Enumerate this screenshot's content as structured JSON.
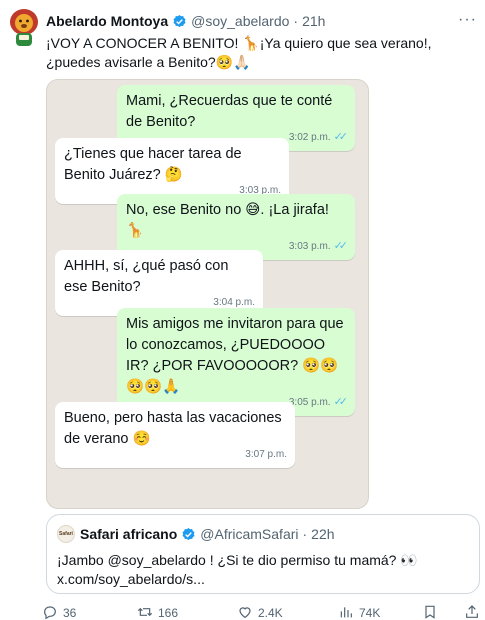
{
  "tweet": {
    "author_name": "Abelardo Montoya",
    "handle": "@soy_abelardo",
    "separator": "·",
    "time": "21h",
    "more": "···",
    "text": "¡VOY A CONOCER A BENITO! 🦒¡Ya quiero que sea verano!, ¿puedes avisarle a Benito?🥺🙏🏻"
  },
  "chat": {
    "messages": [
      {
        "side": "out",
        "text": "Mami, ¿Recuerdas que te conté de Benito?",
        "time": "3:02 p.m.",
        "ticks": "✓✓"
      },
      {
        "side": "in",
        "text": "¿Tienes que hacer tarea de Benito Juárez? 🤔",
        "time": "3:03 p.m."
      },
      {
        "side": "out",
        "text": "No, ese Benito no 😅. ¡La jirafa! 🦒",
        "time": "3:03 p.m.",
        "ticks": "✓✓"
      },
      {
        "side": "in",
        "text": "AHHH, sí, ¿qué pasó con ese Benito?",
        "time": "3:04 p.m."
      },
      {
        "side": "out",
        "text": "Mis amigos me invitaron para que lo conozcamos, ¿PUEDOOOO IR? ¿POR FAVOOOOOR? 🥺🥺🥺🥺🙏",
        "time": "3:05 p.m.",
        "ticks": "✓✓"
      },
      {
        "side": "in",
        "text": "Bueno, pero hasta las vacaciones de verano ☺️",
        "time": "3:07 p.m."
      }
    ]
  },
  "quote": {
    "avatar_text": "Safari",
    "author_name": "Safari africano",
    "handle": "@AfricamSafari",
    "separator": "·",
    "time": "22h",
    "text_line1": "¡Jambo @soy_abelardo ! ¿Si te dio permiso tu mamá? 👀",
    "text_line2": "x.com/soy_abelardo/s..."
  },
  "actions": {
    "replies": "36",
    "reposts": "166",
    "likes": "2.4K",
    "views": "74K"
  },
  "colors": {
    "verified": "#1d9bf0",
    "outgoing_bubble": "#d9fdd3",
    "chat_background": "#eae6df",
    "read_ticks": "#53bdeb"
  }
}
